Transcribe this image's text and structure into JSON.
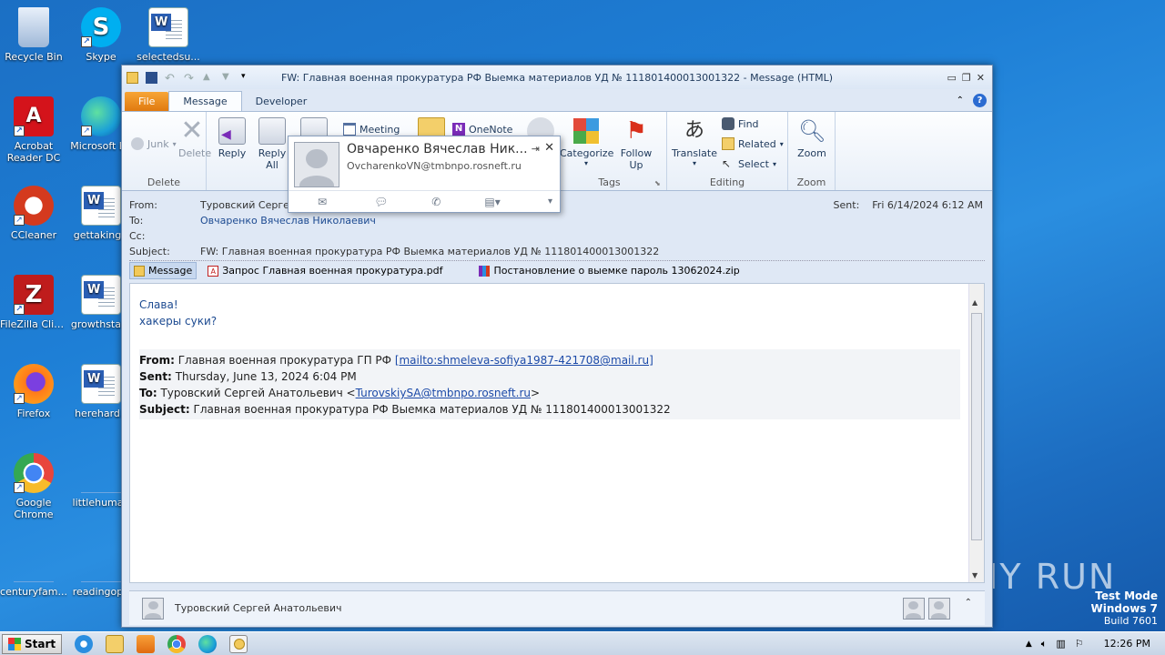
{
  "desktop": {
    "icons": [
      {
        "label": "Recycle Bin",
        "icon": "recycle-bin-icon",
        "color": "#9fb8d8"
      },
      {
        "label": "Skype",
        "icon": "skype-icon",
        "color": "#00aff0"
      },
      {
        "label": "selectedsu...",
        "icon": "word-doc-icon",
        "color": "#ffffff"
      },
      {
        "label": "Acrobat Reader DC",
        "icon": "acrobat-icon",
        "color": "#d4131b"
      },
      {
        "label": "Microsoft Ed",
        "icon": "edge-icon",
        "color": "#1a9fd8"
      },
      {
        "label": "CCleaner",
        "icon": "ccleaner-icon",
        "color": "#d43a1e"
      },
      {
        "label": "gettaking.r",
        "icon": "word-doc-icon",
        "color": "#ffffff"
      },
      {
        "label": "FileZilla Client",
        "icon": "filezilla-icon",
        "color": "#bf1c1c"
      },
      {
        "label": "growthstate",
        "icon": "word-doc-icon",
        "color": "#ffffff"
      },
      {
        "label": "Firefox",
        "icon": "firefox-icon",
        "color": "#ff7a1a"
      },
      {
        "label": "herehard.r",
        "icon": "word-doc-icon",
        "color": "#ffffff"
      },
      {
        "label": "Google Chrome",
        "icon": "chrome-icon",
        "color": "#e8453c"
      },
      {
        "label": "littlehuman",
        "icon": "blank-doc-icon",
        "color": "#2a7fd8"
      },
      {
        "label": "centuryfam...",
        "icon": "blank-doc-icon",
        "color": "#2a7fd8"
      },
      {
        "label": "readingopp",
        "icon": "blank-doc-icon",
        "color": "#2a7fd8"
      }
    ]
  },
  "window": {
    "title": "FW: Главная военная прокуратура РФ Выемка материалов УД № 111801400013001322  -  Message (HTML)",
    "tabs": [
      "File",
      "Message",
      "Developer"
    ],
    "ribbon": {
      "junk": "Junk",
      "delete": "Delete",
      "delete_group": "Delete",
      "reply": "Reply",
      "reply_all": "Reply All",
      "meeting": "Meeting",
      "onenote": "OneNote",
      "categorize": "Categorize",
      "follow_up": "Follow Up",
      "tags_group": "Tags",
      "translate": "Translate",
      "find": "Find",
      "related": "Related",
      "select": "Select",
      "editing_group": "Editing",
      "zoom": "Zoom",
      "zoom_group": "Zoom"
    },
    "header": {
      "from_label": "From:",
      "from_value": "Туровский Сергей А",
      "to_label": "To:",
      "to_value": "Овчаренко Вячеслав Николаевич",
      "cc_label": "Cc:",
      "subject_label": "Subject:",
      "subject_value": "FW: Главная военная прокуратура РФ Выемка материалов УД № 111801400013001322",
      "sent_label": "Sent:",
      "sent_value": "Fri 6/14/2024 6:12 AM"
    },
    "attachments": [
      {
        "name": "Message",
        "icon": "envelope-icon"
      },
      {
        "name": "Запрос Главная военная прокуратура.pdf",
        "icon": "pdf-icon"
      },
      {
        "name": "Постановление о выемке  пароль 13062024.zip",
        "icon": "zip-icon"
      }
    ],
    "body": {
      "greeting": "Слава!",
      "line2": "хакеры суки?",
      "fwd_from_label": "From:",
      "fwd_from_value": "Главная военная прокуратура ГП РФ",
      "fwd_from_link": "[mailto:shmeleva-sofiya1987-421708@mail.ru]",
      "fwd_sent_label": "Sent:",
      "fwd_sent_value": "Thursday, June 13, 2024 6:04 PM",
      "fwd_to_label": "To:",
      "fwd_to_value": "Туровский Сергей Анатольевич",
      "fwd_to_email": "TurovskiySA@tmbnpo.rosneft.ru",
      "fwd_subject_label": "Subject:",
      "fwd_subject_value": "Главная военная прокуратура РФ Выемка материалов УД № 111801400013001322"
    },
    "people_pane": {
      "name": "Туровский Сергей Анатольевич"
    }
  },
  "contact_card": {
    "name": "Овчаренко Вячеслав Ник...",
    "email": "OvcharenkoVN@tmbnpo.rosneft.ru"
  },
  "taskbar": {
    "start_label": "Start",
    "time": "12:26 PM"
  },
  "watermark": {
    "line1": "Test Mode",
    "line2": "Windows 7",
    "line3": "Build 7601",
    "brand": "ANY RUN"
  }
}
